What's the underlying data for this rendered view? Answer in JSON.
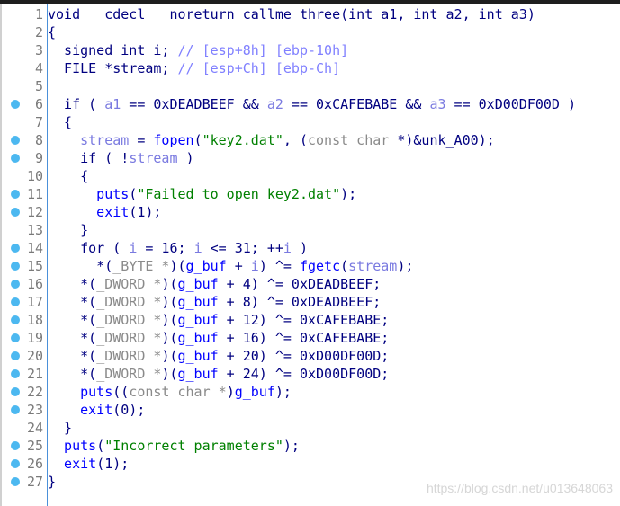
{
  "breakpoint_color": "#4cb8f0",
  "lines": [
    {
      "n": "1",
      "dot": false,
      "t": [
        [
          "k",
          "void __cdecl __noreturn callme_three(int a1, int a2, int a3)"
        ]
      ]
    },
    {
      "n": "2",
      "dot": false,
      "t": [
        [
          "k",
          "{"
        ]
      ]
    },
    {
      "n": "3",
      "dot": false,
      "t": [
        [
          "k",
          "  signed int i; "
        ],
        [
          "c",
          "// [esp+8h] [ebp-10h]"
        ]
      ]
    },
    {
      "n": "4",
      "dot": false,
      "t": [
        [
          "k",
          "  FILE *stream; "
        ],
        [
          "c",
          "// [esp+Ch] [ebp-Ch]"
        ]
      ]
    },
    {
      "n": "5",
      "dot": false,
      "t": [
        [
          "k",
          ""
        ]
      ]
    },
    {
      "n": "6",
      "dot": true,
      "t": [
        [
          "k",
          "  if ( "
        ],
        [
          "v",
          "a1"
        ],
        [
          "k",
          " == 0xDEADBEEF && "
        ],
        [
          "v",
          "a2"
        ],
        [
          "k",
          " == 0xCAFEBABE && "
        ],
        [
          "v",
          "a3"
        ],
        [
          "k",
          " == 0xD00DF00D )"
        ]
      ]
    },
    {
      "n": "7",
      "dot": false,
      "t": [
        [
          "k",
          "  {"
        ]
      ]
    },
    {
      "n": "8",
      "dot": true,
      "t": [
        [
          "v",
          "    stream"
        ],
        [
          "k",
          " = "
        ],
        [
          "f",
          "fopen"
        ],
        [
          "k",
          "("
        ],
        [
          "s",
          "\"key2.dat\""
        ],
        [
          "k",
          ", ("
        ],
        [
          "g",
          "const char"
        ],
        [
          "k",
          " *)&unk_A00);"
        ]
      ]
    },
    {
      "n": "9",
      "dot": true,
      "t": [
        [
          "k",
          "    if ( !"
        ],
        [
          "v",
          "stream"
        ],
        [
          "k",
          " )"
        ]
      ]
    },
    {
      "n": "10",
      "dot": false,
      "t": [
        [
          "k",
          "    {"
        ]
      ]
    },
    {
      "n": "11",
      "dot": true,
      "t": [
        [
          "f",
          "      puts"
        ],
        [
          "k",
          "("
        ],
        [
          "s",
          "\"Failed to open key2.dat\""
        ],
        [
          "k",
          ");"
        ]
      ]
    },
    {
      "n": "12",
      "dot": true,
      "t": [
        [
          "f",
          "      exit"
        ],
        [
          "k",
          "(1);"
        ]
      ]
    },
    {
      "n": "13",
      "dot": false,
      "t": [
        [
          "k",
          "    }"
        ]
      ]
    },
    {
      "n": "14",
      "dot": true,
      "t": [
        [
          "k",
          "    for ( "
        ],
        [
          "v",
          "i"
        ],
        [
          "k",
          " = 16; "
        ],
        [
          "v",
          "i"
        ],
        [
          "k",
          " <= 31; ++"
        ],
        [
          "v",
          "i"
        ],
        [
          "k",
          " )"
        ]
      ]
    },
    {
      "n": "15",
      "dot": true,
      "t": [
        [
          "k",
          "      *("
        ],
        [
          "g",
          "_BYTE"
        ],
        [
          "g",
          " *"
        ],
        [
          "k",
          ")("
        ],
        [
          "b",
          "g_buf"
        ],
        [
          "k",
          " + "
        ],
        [
          "v",
          "i"
        ],
        [
          "k",
          ") ^= "
        ],
        [
          "f",
          "fgetc"
        ],
        [
          "k",
          "("
        ],
        [
          "v",
          "stream"
        ],
        [
          "k",
          ");"
        ]
      ]
    },
    {
      "n": "16",
      "dot": true,
      "t": [
        [
          "k",
          "    *("
        ],
        [
          "g",
          "_DWORD *"
        ],
        [
          "k",
          ")("
        ],
        [
          "b",
          "g_buf"
        ],
        [
          "k",
          " + 4) ^= 0xDEADBEEF;"
        ]
      ]
    },
    {
      "n": "17",
      "dot": true,
      "t": [
        [
          "k",
          "    *("
        ],
        [
          "g",
          "_DWORD *"
        ],
        [
          "k",
          ")("
        ],
        [
          "b",
          "g_buf"
        ],
        [
          "k",
          " + 8) ^= 0xDEADBEEF;"
        ]
      ]
    },
    {
      "n": "18",
      "dot": true,
      "t": [
        [
          "k",
          "    *("
        ],
        [
          "g",
          "_DWORD *"
        ],
        [
          "k",
          ")("
        ],
        [
          "b",
          "g_buf"
        ],
        [
          "k",
          " + 12) ^= 0xCAFEBABE;"
        ]
      ]
    },
    {
      "n": "19",
      "dot": true,
      "t": [
        [
          "k",
          "    *("
        ],
        [
          "g",
          "_DWORD *"
        ],
        [
          "k",
          ")("
        ],
        [
          "b",
          "g_buf"
        ],
        [
          "k",
          " + 16) ^= 0xCAFEBABE;"
        ]
      ]
    },
    {
      "n": "20",
      "dot": true,
      "t": [
        [
          "k",
          "    *("
        ],
        [
          "g",
          "_DWORD *"
        ],
        [
          "k",
          ")("
        ],
        [
          "b",
          "g_buf"
        ],
        [
          "k",
          " + 20) ^= 0xD00DF00D;"
        ]
      ]
    },
    {
      "n": "21",
      "dot": true,
      "t": [
        [
          "k",
          "    *("
        ],
        [
          "g",
          "_DWORD *"
        ],
        [
          "k",
          ")("
        ],
        [
          "b",
          "g_buf"
        ],
        [
          "k",
          " + 24) ^= 0xD00DF00D;"
        ]
      ]
    },
    {
      "n": "22",
      "dot": true,
      "t": [
        [
          "f",
          "    puts"
        ],
        [
          "k",
          "(("
        ],
        [
          "g",
          "const char *"
        ],
        [
          "k",
          ")"
        ],
        [
          "b",
          "g_buf"
        ],
        [
          "k",
          ");"
        ]
      ]
    },
    {
      "n": "23",
      "dot": true,
      "t": [
        [
          "f",
          "    exit"
        ],
        [
          "k",
          "(0);"
        ]
      ]
    },
    {
      "n": "24",
      "dot": false,
      "t": [
        [
          "k",
          "  }"
        ]
      ]
    },
    {
      "n": "25",
      "dot": true,
      "t": [
        [
          "f",
          "  puts"
        ],
        [
          "k",
          "("
        ],
        [
          "s",
          "\"Incorrect parameters\""
        ],
        [
          "k",
          ");"
        ]
      ]
    },
    {
      "n": "26",
      "dot": true,
      "t": [
        [
          "f",
          "  exit"
        ],
        [
          "k",
          "(1);"
        ]
      ]
    },
    {
      "n": "27",
      "dot": true,
      "t": [
        [
          "k",
          "}"
        ]
      ]
    }
  ],
  "watermark": "https://blog.csdn.net/u013648063"
}
